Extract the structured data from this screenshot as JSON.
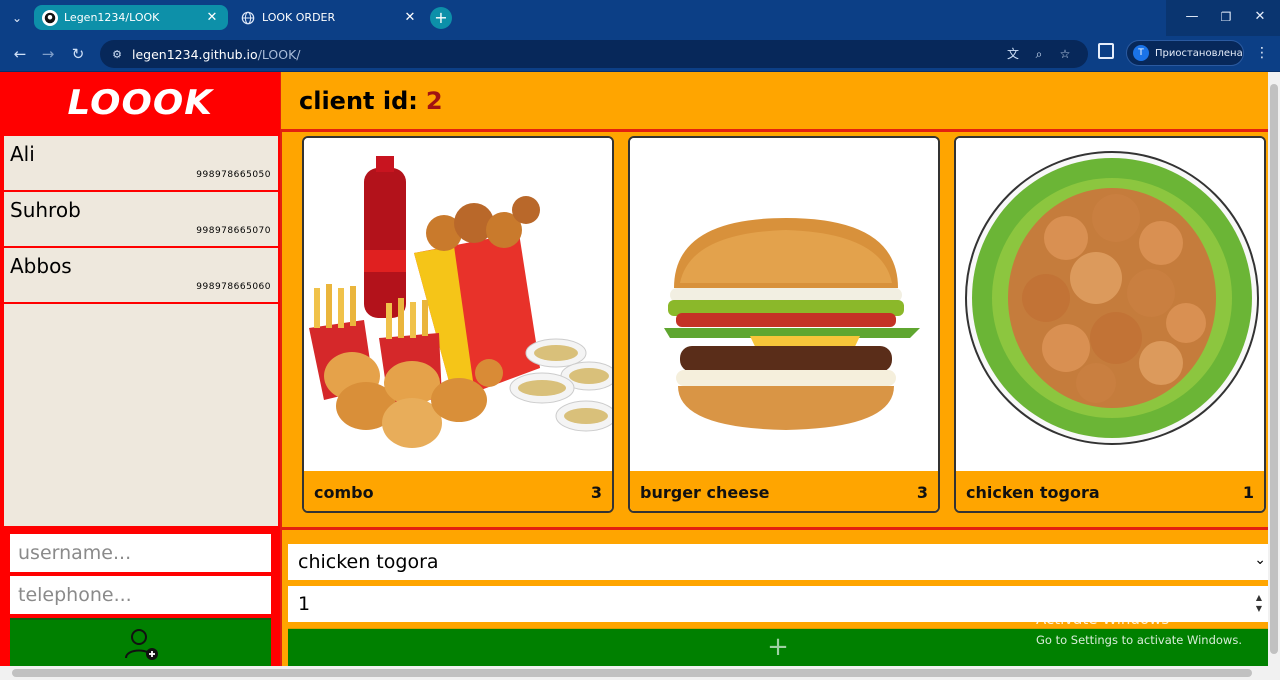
{
  "browser": {
    "tabs": [
      {
        "title": "Legen1234/LOOK",
        "icon": "github-icon",
        "active": true
      },
      {
        "title": "LOOK ORDER",
        "icon": "globe-icon",
        "active": false
      }
    ],
    "url_host": "legen1234.github.io",
    "url_path": "/LOOK/",
    "profile_initial": "T",
    "profile_name": "Приостановлена"
  },
  "app": {
    "logo": "LOOOK",
    "client_label": "client id:",
    "client_id": "2",
    "clients": [
      {
        "name": "Ali",
        "phone": "998978665050"
      },
      {
        "name": "Suhrob",
        "phone": "998978665070"
      },
      {
        "name": "Abbos",
        "phone": "998978665060"
      }
    ],
    "username_placeholder": "username...",
    "telephone_placeholder": "telephone...",
    "products": [
      {
        "name": "combo",
        "count": "3"
      },
      {
        "name": "burger cheese",
        "count": "3"
      },
      {
        "name": "chicken togora",
        "count": "1"
      }
    ],
    "selected_food": "chicken togora",
    "order_count": "1",
    "add_order_label": "+"
  },
  "os": {
    "activate_title": "Activate Windows",
    "activate_sub": "Go to Settings to activate Windows."
  },
  "colors": {
    "accent_red": "#ff0000",
    "accent_orange": "#ffa500",
    "button_green": "#008000",
    "client_id_color": "#a11212"
  }
}
